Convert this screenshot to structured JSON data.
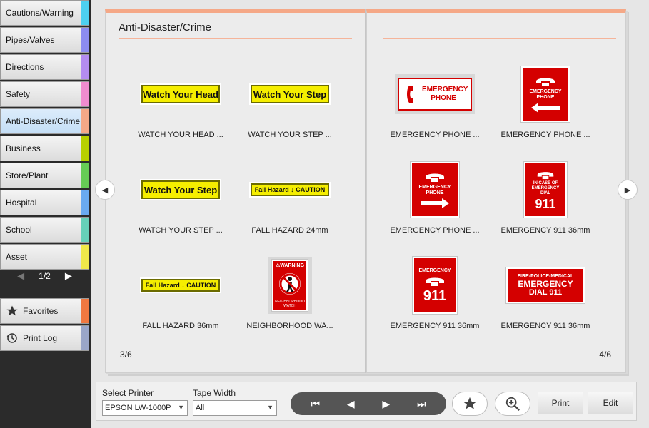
{
  "sidebar": {
    "categories": [
      {
        "label": "Cautions/Warning",
        "color": "#4dd0f0"
      },
      {
        "label": "Pipes/Valves",
        "color": "#8c8cf0"
      },
      {
        "label": "Directions",
        "color": "#b48cf0"
      },
      {
        "label": "Safety",
        "color": "#f08ccf"
      },
      {
        "label": "Anti-Disaster/Crime",
        "color": "#f5a887",
        "active": true
      },
      {
        "label": "Business",
        "color": "#b8d000"
      },
      {
        "label": "Store/Plant",
        "color": "#66cc55"
      },
      {
        "label": "Hospital",
        "color": "#6aaaf0"
      },
      {
        "label": "School",
        "color": "#66d0b8"
      },
      {
        "label": "Asset",
        "color": "#f0e84a"
      }
    ],
    "pager": {
      "text": "1/2",
      "prev": "◀",
      "next": "▶"
    },
    "favorites": {
      "label": "Favorites",
      "color": "#f07840",
      "icon": "star-icon"
    },
    "print_log": {
      "label": "Print Log",
      "color": "#9aa6c8",
      "icon": "history-icon"
    }
  },
  "book": {
    "left_page": {
      "title": "Anti-Disaster/Crime",
      "page_number": "3/6",
      "items": [
        {
          "caption": "WATCH YOUR HEAD ...",
          "label_text": "Watch Your Head"
        },
        {
          "caption": "WATCH YOUR STEP ...",
          "label_text": "Watch Your Step"
        },
        {
          "caption": "WATCH YOUR STEP ...",
          "label_text": "Watch Your Step"
        },
        {
          "caption": "FALL HAZARD 24mm",
          "label_text": "Fall Hazard ↓ CAUTION"
        },
        {
          "caption": "FALL HAZARD 36mm",
          "label_text": "Fall Hazard ↓ CAUTION"
        },
        {
          "caption": "NEIGHBORHOOD WA...",
          "label_top": "⚠WARNING",
          "label_bottom": "NEIGHBORHOOD WATCH"
        }
      ]
    },
    "right_page": {
      "page_number": "4/6",
      "items": [
        {
          "caption": "EMERGENCY PHONE ...",
          "label_text": "EMERGENCY PHONE"
        },
        {
          "caption": "EMERGENCY PHONE ...",
          "label_text": "EMERGENCY PHONE"
        },
        {
          "caption": "EMERGENCY PHONE ...",
          "label_text": "EMERGENCY PHONE"
        },
        {
          "caption": "EMERGENCY 911 36mm",
          "label_line1": "IN CASE OF EMERGENCY DIAL",
          "label_line2": "911"
        },
        {
          "caption": "EMERGENCY 911 36mm",
          "label_line1": "EMERGENCY",
          "label_line2": "911"
        },
        {
          "caption": "EMERGENCY 911 36mm",
          "label_line1": "FIRE-POLICE-MEDICAL",
          "label_line2": "EMERGENCY",
          "label_line3": "DIAL 911"
        }
      ]
    },
    "prev_arrow": "◀",
    "next_arrow": "▶"
  },
  "bottombar": {
    "printer_label": "Select Printer",
    "printer_value": "EPSON LW-1000P",
    "tape_label": "Tape Width",
    "tape_value": "All",
    "nav": {
      "first": "⏮",
      "prev": "◀",
      "next": "▶",
      "last": "⏭"
    },
    "print_label": "Print",
    "edit_label": "Edit"
  }
}
